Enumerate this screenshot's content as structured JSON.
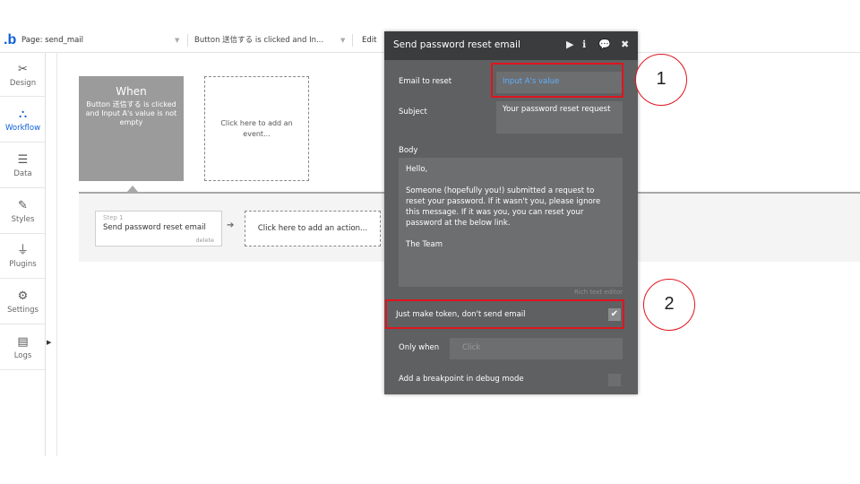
{
  "topbar": {
    "logo": ".b",
    "page_label": "Page: send_mail",
    "caret": "▼",
    "event_label": "Button 送信する is clicked and In...",
    "edit_label": "Edit"
  },
  "sidebar": {
    "items": [
      {
        "label": "Design",
        "icon": "design-icon"
      },
      {
        "label": "Workflow",
        "icon": "workflow-icon"
      },
      {
        "label": "Data",
        "icon": "data-icon"
      },
      {
        "label": "Styles",
        "icon": "styles-icon"
      },
      {
        "label": "Plugins",
        "icon": "plugins-icon"
      },
      {
        "label": "Settings",
        "icon": "settings-icon"
      },
      {
        "label": "Logs",
        "icon": "logs-icon"
      }
    ],
    "active_color": "#0d5fd8"
  },
  "canvas": {
    "when_title": "When",
    "when_desc": "Button 送信する is clicked and Input A's value is not empty",
    "add_event": "Click here to add an event...",
    "step": {
      "number": "Step 1",
      "name": "Send password reset email",
      "delete": "delete"
    },
    "add_action": "Click here to add an action..."
  },
  "panel": {
    "title": "Send password reset email",
    "email_label": "Email to reset",
    "email_value": "Input A's value",
    "subject_label": "Subject",
    "subject_value": "Your password reset request",
    "body_label": "Body",
    "body_value": "Hello,\n\nSomeone (hopefully you!) submitted a request to reset your password. If it wasn't you, please ignore this message. If it was you, you can reset your password at the below link.\n\nThe Team",
    "rich_text": "Rich text editor",
    "token_label": "Just make token, don't send email",
    "token_checked": true,
    "only_when_label": "Only when",
    "only_when_placeholder": "Click",
    "breakpoint_label": "Add a breakpoint in debug mode",
    "breakpoint_checked": false
  },
  "annotations": {
    "one": "1",
    "two": "2",
    "color": "#e0141e"
  }
}
